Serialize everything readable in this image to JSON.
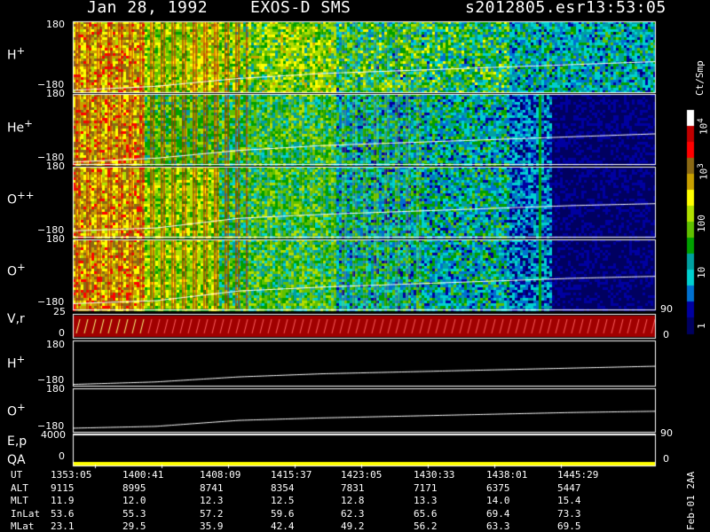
{
  "header": {
    "date": "Jan 28, 1992",
    "instrument": "EXOS-D SMS",
    "file": "s2012805.esr",
    "time": "13:53:05"
  },
  "panels": [
    {
      "label": "H",
      "sup": "+",
      "ytop": "180",
      "ybot": "−180"
    },
    {
      "label": "He",
      "sup": "+",
      "ytop": "180",
      "ybot": "−180"
    },
    {
      "label": "O",
      "sup": "++",
      "ytop": "180",
      "ybot": "−180"
    },
    {
      "label": "O",
      "sup": "+",
      "ytop": "180",
      "ybot": "−180"
    },
    {
      "label": "V,r",
      "sup": "",
      "ytop": "25",
      "ybot": "0"
    },
    {
      "label": "H",
      "sup": "+",
      "ytop": "180",
      "ybot": "−180"
    },
    {
      "label": "O",
      "sup": "+",
      "ytop": "180",
      "ybot": "−180"
    },
    {
      "label": "E,p",
      "sup": "",
      "ytop": "4000",
      "ybot": ""
    },
    {
      "label": "QA",
      "sup": "",
      "ytop": "",
      "ybot": "0"
    }
  ],
  "right_axis": {
    "vr_top": "90",
    "vr_bot": "0",
    "ep_top": "90",
    "ep_bot": "0"
  },
  "colorbar": {
    "title": "Ct/Smp",
    "ticks": [
      {
        "base": "10",
        "exp": "4"
      },
      {
        "base": "10",
        "exp": "3"
      },
      {
        "base": "100",
        "exp": ""
      },
      {
        "base": "10",
        "exp": ""
      },
      {
        "base": "1",
        "exp": ""
      }
    ],
    "colors": [
      "#ffffff",
      "#c00000",
      "#ff0000",
      "#8b6914",
      "#c8a000",
      "#ffff00",
      "#b0e000",
      "#60c000",
      "#00a000",
      "#00a0a0",
      "#00d0d0",
      "#0070d0",
      "#0000a0",
      "#000060"
    ]
  },
  "footer": {
    "rows": [
      {
        "name": "UT",
        "values": [
          "1353:05",
          "1400:41",
          "1408:09",
          "1415:37",
          "1423:05",
          "1430:33",
          "1438:01",
          "1445:29"
        ]
      },
      {
        "name": "ALT",
        "values": [
          "9115",
          "8995",
          "8741",
          "8354",
          "7831",
          "7171",
          "6375",
          "5447"
        ]
      },
      {
        "name": "MLT",
        "values": [
          "11.9",
          "12.0",
          "12.3",
          "12.5",
          "12.8",
          "13.3",
          "14.0",
          "15.4"
        ]
      },
      {
        "name": "InLat",
        "values": [
          "53.6",
          "55.3",
          "57.2",
          "59.6",
          "62.3",
          "65.6",
          "69.4",
          "73.3"
        ]
      },
      {
        "name": "MLat",
        "values": [
          "23.1",
          "29.5",
          "35.9",
          "42.4",
          "49.2",
          "56.2",
          "63.3",
          "69.5"
        ]
      }
    ],
    "stamp": "Feb-01 2AA"
  },
  "chart_data": {
    "type": "heatmap",
    "x": [
      "1353:05",
      "1400:41",
      "1408:09",
      "1415:37",
      "1423:05",
      "1430:33",
      "1438:01",
      "1445:29"
    ],
    "spectrogram_ylim": [
      -180,
      180
    ],
    "vr_ylim": [
      0,
      25
    ],
    "colorbar_range": [
      1,
      10000
    ],
    "colorbar_scale": "log",
    "line_series": [
      {
        "name": "H+",
        "values": [
          -170,
          -150,
          -110,
          -85,
          -70,
          -55,
          -40,
          -25
        ]
      },
      {
        "name": "O+",
        "values": [
          -150,
          -135,
          -85,
          -65,
          -50,
          -35,
          -20,
          -10
        ]
      }
    ]
  }
}
